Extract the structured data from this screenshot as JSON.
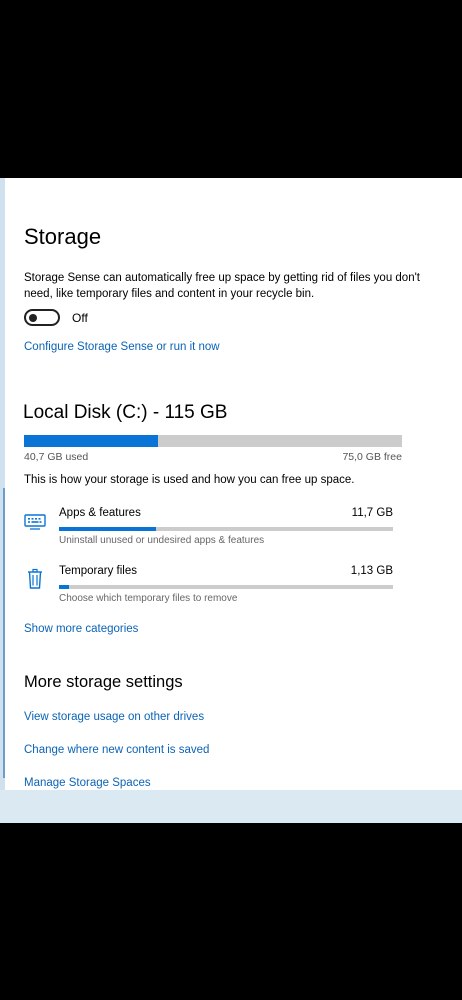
{
  "storage": {
    "title": "Storage",
    "description": "Storage Sense can automatically free up space by getting rid of files you don't need, like temporary files and content in your recycle bin.",
    "toggle_state": "Off",
    "configure_link": "Configure Storage Sense or run it now"
  },
  "disk": {
    "title": "Local Disk (C:) - 115 GB",
    "used_label": "40,7 GB used",
    "free_label": "75,0 GB free",
    "used_fraction": 0.354,
    "info_text": "This is how your storage is used and how you can free up space."
  },
  "categories": [
    {
      "name": "Apps & features",
      "size": "11,7 GB",
      "description": "Uninstall unused or undesired apps & features",
      "icon": "keyboard-icon",
      "fill_fraction": 0.29
    },
    {
      "name": "Temporary files",
      "size": "1,13 GB",
      "description": "Choose which temporary files to remove",
      "icon": "trash-icon",
      "fill_fraction": 0.03
    }
  ],
  "show_more_link": "Show more categories",
  "more_settings": {
    "title": "More storage settings",
    "links": [
      "View storage usage on other drives",
      "Change where new content is saved",
      "Manage Storage Spaces"
    ]
  },
  "colors": {
    "accent": "#0a74d6",
    "link": "#0b63b6",
    "bar_track": "#cccccc"
  }
}
